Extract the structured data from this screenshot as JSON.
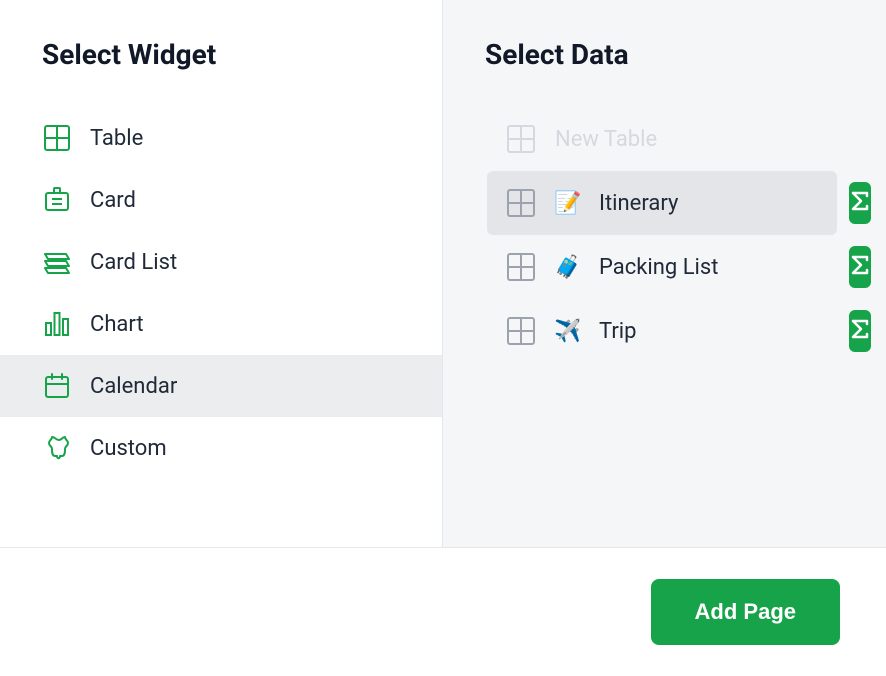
{
  "left": {
    "title": "Select Widget",
    "items": [
      {
        "label": "Table",
        "icon": "table-icon",
        "selected": false
      },
      {
        "label": "Card",
        "icon": "card-icon",
        "selected": false
      },
      {
        "label": "Card List",
        "icon": "cardlist-icon",
        "selected": false
      },
      {
        "label": "Chart",
        "icon": "chart-icon",
        "selected": false
      },
      {
        "label": "Calendar",
        "icon": "calendar-icon",
        "selected": true
      },
      {
        "label": "Custom",
        "icon": "custom-icon",
        "selected": false
      }
    ]
  },
  "right": {
    "title": "Select Data",
    "items": [
      {
        "label": "New Table",
        "emoji": "",
        "type": "new",
        "selected": false,
        "sigma": false
      },
      {
        "label": "Itinerary",
        "emoji": "📝",
        "type": "normal",
        "selected": true,
        "sigma": true
      },
      {
        "label": "Packing List",
        "emoji": "🧳",
        "type": "normal",
        "selected": false,
        "sigma": true
      },
      {
        "label": "Trip",
        "emoji": "✈️",
        "type": "normal",
        "selected": false,
        "sigma": true
      }
    ]
  },
  "footer": {
    "add_page_label": "Add Page"
  },
  "colors": {
    "accent": "#16a34a",
    "bg_right": "#f5f6f8",
    "selected_left": "#ebedef",
    "selected_right": "#e3e5e8"
  }
}
